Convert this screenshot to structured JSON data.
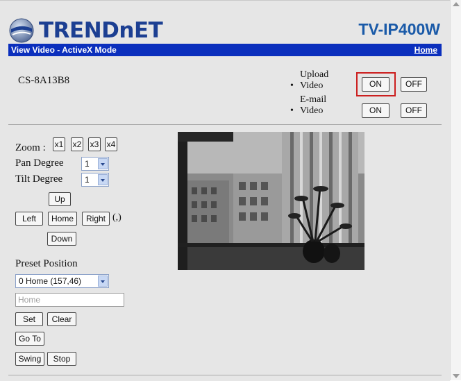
{
  "brand": {
    "logo_text": "TRENDnET",
    "model": "TV-IP400W"
  },
  "nav": {
    "mode_title": "View Video - ActiveX Mode",
    "home_link": "Home"
  },
  "camera": {
    "name": "CS-8A13B8"
  },
  "notifications": {
    "upload_label": "Upload",
    "upload_video": "Video",
    "email_label": "E-mail",
    "email_video": "Video",
    "upload_on": "ON",
    "upload_off": "OFF",
    "email_on": "ON",
    "email_off": "OFF"
  },
  "controls": {
    "zoom_label": "Zoom :",
    "zoom_buttons": [
      "x1",
      "x2",
      "x3",
      "x4"
    ],
    "pan_label": "Pan Degree",
    "pan_value": "1",
    "tilt_label": "Tilt Degree",
    "tilt_value": "1",
    "up": "Up",
    "left": "Left",
    "home": "Home",
    "right": "Right",
    "comma": "(,)",
    "down": "Down"
  },
  "preset": {
    "label": "Preset Position",
    "selected": "0 Home (157,46)",
    "name_placeholder": "Home",
    "set": "Set",
    "clear": "Clear",
    "goto": "Go To",
    "swing": "Swing",
    "stop": "Stop"
  },
  "colors": {
    "bar": "#0b2fbd",
    "brand": "#1c3f92",
    "model": "#1a5aa8",
    "highlight": "#cc1f1f"
  }
}
